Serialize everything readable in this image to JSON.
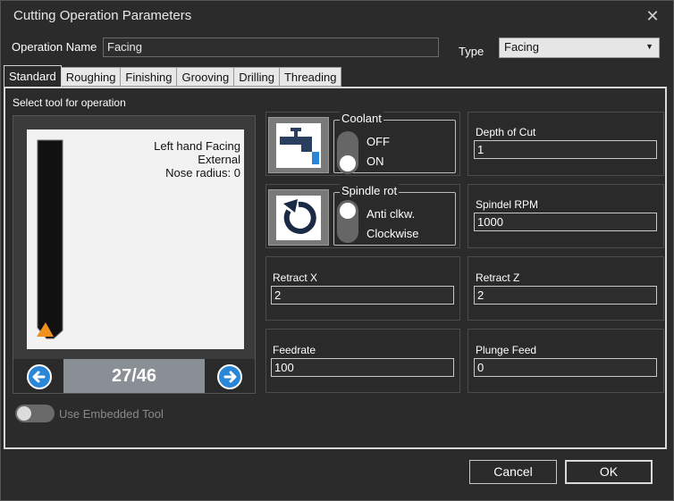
{
  "window": {
    "title": "Cutting Operation Parameters"
  },
  "operation": {
    "name_label": "Operation Name",
    "name_value": "Facing"
  },
  "type": {
    "label": "Type",
    "value": "Facing"
  },
  "tabs": [
    {
      "label": "Standard",
      "active": true
    },
    {
      "label": "Roughing"
    },
    {
      "label": "Finishing"
    },
    {
      "label": "Grooving"
    },
    {
      "label": "Drilling"
    },
    {
      "label": "Threading"
    }
  ],
  "tool": {
    "section_label": "Select tool for operation",
    "preview_lines": [
      "Left hand Facing",
      "External",
      "Nose radius: 0"
    ],
    "counter": "27/46",
    "embedded_label": "Use Embedded Tool"
  },
  "coolant": {
    "title": "Coolant",
    "options": [
      "OFF",
      "ON"
    ],
    "selected": "ON"
  },
  "spindle": {
    "title": "Spindle rot",
    "options": [
      "Anti clkw.",
      "Clockwise"
    ],
    "selected": "Anti clkw."
  },
  "fields": {
    "depth_of_cut": {
      "label": "Depth of Cut",
      "value": "1"
    },
    "spindle_rpm": {
      "label": "Spindel RPM",
      "value": "1000"
    },
    "retract_x": {
      "label": "Retract X",
      "value": "2"
    },
    "retract_z": {
      "label": "Retract Z",
      "value": "2"
    },
    "feedrate": {
      "label": "Feedrate",
      "value": "100"
    },
    "plunge_feed": {
      "label": "Plunge Feed",
      "value": "0"
    }
  },
  "buttons": {
    "cancel": "Cancel",
    "ok": "OK"
  },
  "colors": {
    "background": "#2b2b2b",
    "accent": "#2a86d6",
    "tool_insert": "#f0901e"
  }
}
